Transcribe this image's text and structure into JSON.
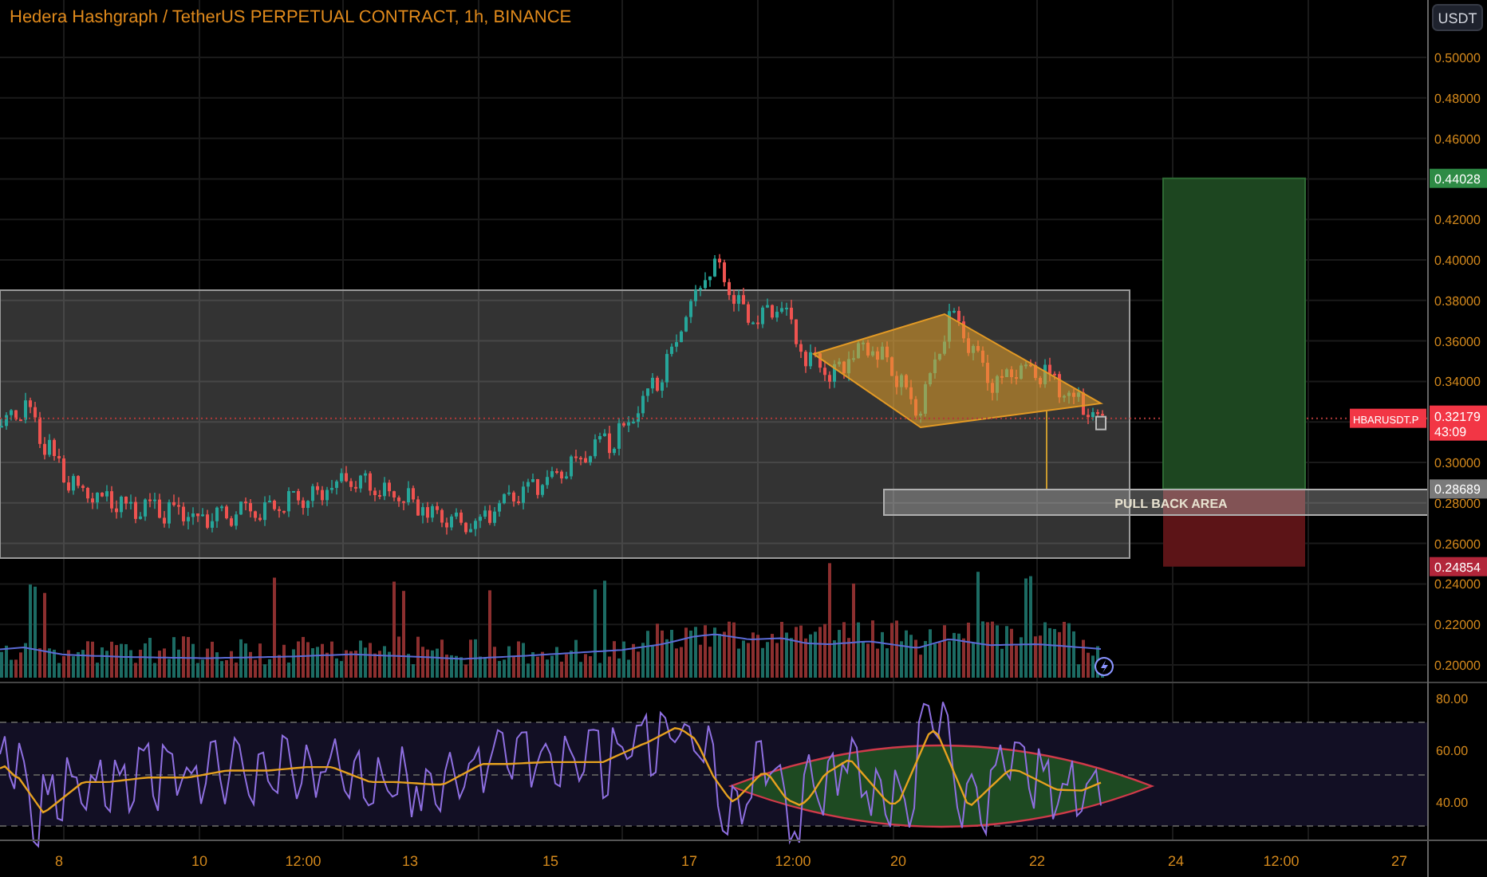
{
  "title": "Hedera Hashgraph / TetherUS PERPETUAL CONTRACT, 1h, BINANCE",
  "currency_button": "USDT",
  "price_axis": [
    "0.50000",
    "0.48000",
    "0.46000",
    "0.42000",
    "0.40000",
    "0.38000",
    "0.36000",
    "0.34000",
    "0.30000",
    "0.28000",
    "0.26000",
    "0.24000",
    "0.22000",
    "0.20000"
  ],
  "price_tags": [
    {
      "text": "0.44028",
      "kind": "target"
    },
    {
      "text": "0.28689",
      "kind": "entry"
    },
    {
      "text": "0.24854",
      "kind": "stop"
    }
  ],
  "last_price": {
    "symbol": "HBARUSDT.P",
    "price": "0.32179",
    "countdown": "43:09"
  },
  "zone_label": "PULL BACK AREA",
  "rsi_axis": [
    "80.00",
    "60.00",
    "40.00"
  ],
  "time_axis": [
    "8",
    "10",
    "12:00",
    "13",
    "15",
    "17",
    "12:00",
    "20",
    "22",
    "24",
    "12:00",
    "27"
  ]
}
